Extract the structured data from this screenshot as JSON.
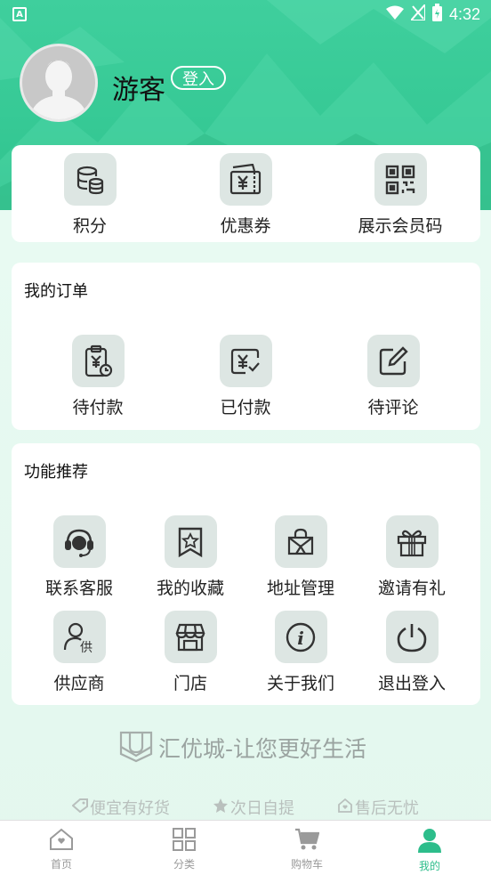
{
  "status_bar": {
    "left_icon": "A",
    "time": "4:32",
    "icons": [
      "wifi-icon",
      "signal-icon",
      "battery-icon"
    ]
  },
  "profile": {
    "username": "游客",
    "login_label": "登入"
  },
  "quick": [
    {
      "label": "积分",
      "icon": "coins-icon"
    },
    {
      "label": "优惠券",
      "icon": "coupon-icon"
    },
    {
      "label": "展示会员码",
      "icon": "qrcode-icon"
    }
  ],
  "orders": {
    "title": "我的订单",
    "items": [
      {
        "label": "待付款",
        "icon": "pending-payment-icon"
      },
      {
        "label": "已付款",
        "icon": "paid-icon"
      },
      {
        "label": "待评论",
        "icon": "review-icon"
      }
    ]
  },
  "features": {
    "title": "功能推荐",
    "items": [
      {
        "label": "联系客服",
        "icon": "headset-icon"
      },
      {
        "label": "我的收藏",
        "icon": "bookmark-star-icon"
      },
      {
        "label": "地址管理",
        "icon": "address-icon"
      },
      {
        "label": "邀请有礼",
        "icon": "gift-icon"
      },
      {
        "label": "供应商",
        "icon": "supplier-icon"
      },
      {
        "label": "门店",
        "icon": "store-icon"
      },
      {
        "label": "关于我们",
        "icon": "info-icon"
      },
      {
        "label": "退出登入",
        "icon": "power-icon"
      }
    ]
  },
  "slogan": "汇优城-让您更好生活",
  "badges": [
    {
      "label": "便宜有好货",
      "icon": "tag-icon"
    },
    {
      "label": "次日自提",
      "icon": "star-icon"
    },
    {
      "label": "售后无忧",
      "icon": "home-heart-icon"
    }
  ],
  "tabs": [
    {
      "label": "首页",
      "icon": "home-icon"
    },
    {
      "label": "分类",
      "icon": "category-icon"
    },
    {
      "label": "购物车",
      "icon": "cart-icon"
    },
    {
      "label": "我的",
      "icon": "profile-icon",
      "active": true
    }
  ],
  "colors": {
    "accent": "#2dbd8b",
    "header": "#3fcf9d",
    "icon_bg": "#dde6e3",
    "icon_stroke": "#333333"
  }
}
